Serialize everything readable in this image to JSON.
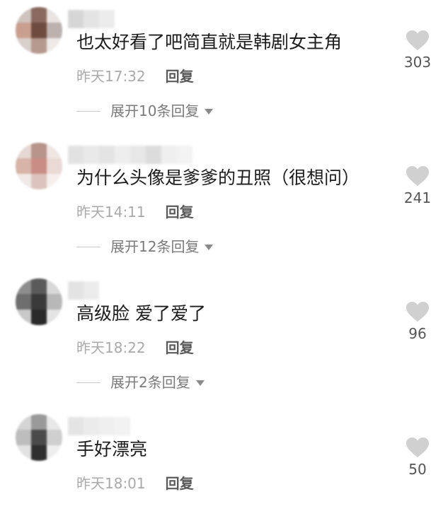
{
  "comments": [
    {
      "text": "也太好看了吧简直就是韩剧女主角",
      "time": "昨天17:32",
      "reply_label": "回复",
      "expand_label": "展开10条回复",
      "likes": "303",
      "avatar_colors": [
        "#cfc3be",
        "#8a6a60",
        "#e9e4e2",
        "#c9a08f",
        "#6e4a3f",
        "#bdb1ad",
        "#d9cfcb",
        "#b69a90",
        "#eeeae8"
      ]
    },
    {
      "text": "为什么头像是爹爹的丑照（很想问）",
      "time": "昨天14:11",
      "reply_label": "回复",
      "expand_label": "展开12条回复",
      "likes": "241",
      "avatar_colors": [
        "#e6d8d2",
        "#b8948a",
        "#efe6e2",
        "#d7b3a8",
        "#c98d86",
        "#ead9d4",
        "#f1e9e6",
        "#dcc4bd",
        "#f5efed"
      ]
    },
    {
      "text": "高级脸 爱了爱了",
      "time": "昨天18:22",
      "reply_label": "回复",
      "expand_label": "展开2条回复",
      "likes": "96",
      "avatar_colors": [
        "#8d8d8d",
        "#5a5a5a",
        "#d8d8d8",
        "#6e6e6e",
        "#3a3a3a",
        "#b8b8b8",
        "#c9c9c9",
        "#2a2a2a",
        "#e4e4e4"
      ]
    },
    {
      "text": "手好漂亮",
      "time": "昨天18:01",
      "reply_label": "回复",
      "expand_label": "",
      "likes": "50",
      "avatar_colors": [
        "#d5d5d5",
        "#9a9a9a",
        "#e8e8e8",
        "#bdbdbd",
        "#4a4a4a",
        "#cfcfcf",
        "#e2e2e2",
        "#2f2f2f",
        "#eeeeee"
      ]
    }
  ]
}
